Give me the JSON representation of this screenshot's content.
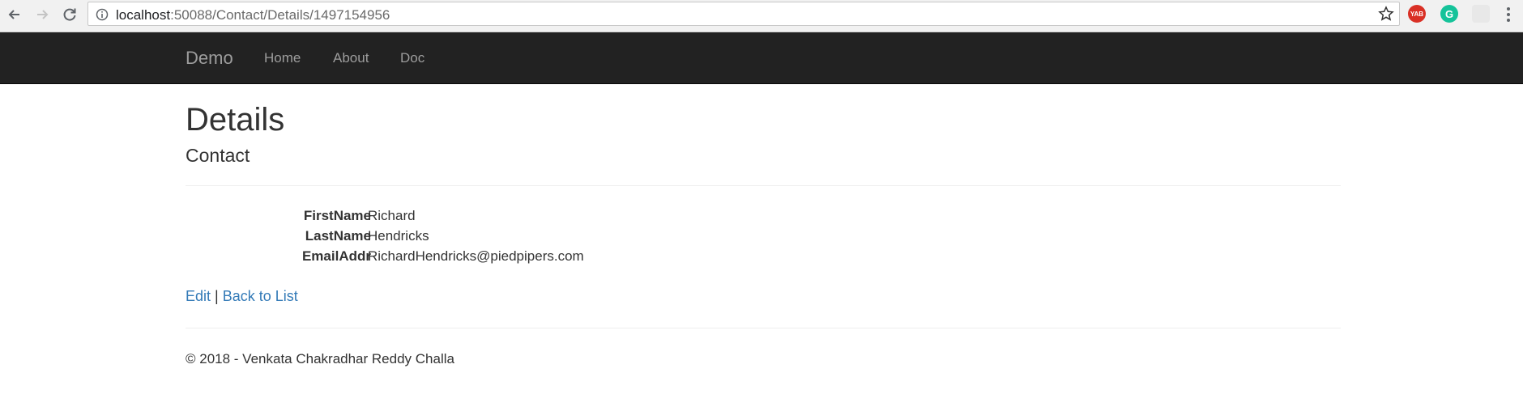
{
  "browser": {
    "url_host": "localhost",
    "url_path": ":50088/Contact/Details/1497154956",
    "extensions": [
      "yab-icon",
      "grammarly-icon",
      "extension-icon"
    ]
  },
  "navbar": {
    "brand": "Demo",
    "links": [
      "Home",
      "About",
      "Doc"
    ]
  },
  "page": {
    "title": "Details",
    "subtitle": "Contact"
  },
  "details": [
    {
      "label": "FirstName",
      "value": "Richard"
    },
    {
      "label": "LastName",
      "value": "Hendricks"
    },
    {
      "label": "EmailAddr",
      "value": "RichardHendricks@piedpipers.com"
    }
  ],
  "actions": {
    "edit": "Edit",
    "separator": "|",
    "back": "Back to List"
  },
  "footer": {
    "text": "© 2018 - Venkata Chakradhar Reddy Challa"
  },
  "colors": {
    "navbar_bg": "#222222",
    "link": "#337ab7",
    "nav_text": "#9d9d9d"
  }
}
